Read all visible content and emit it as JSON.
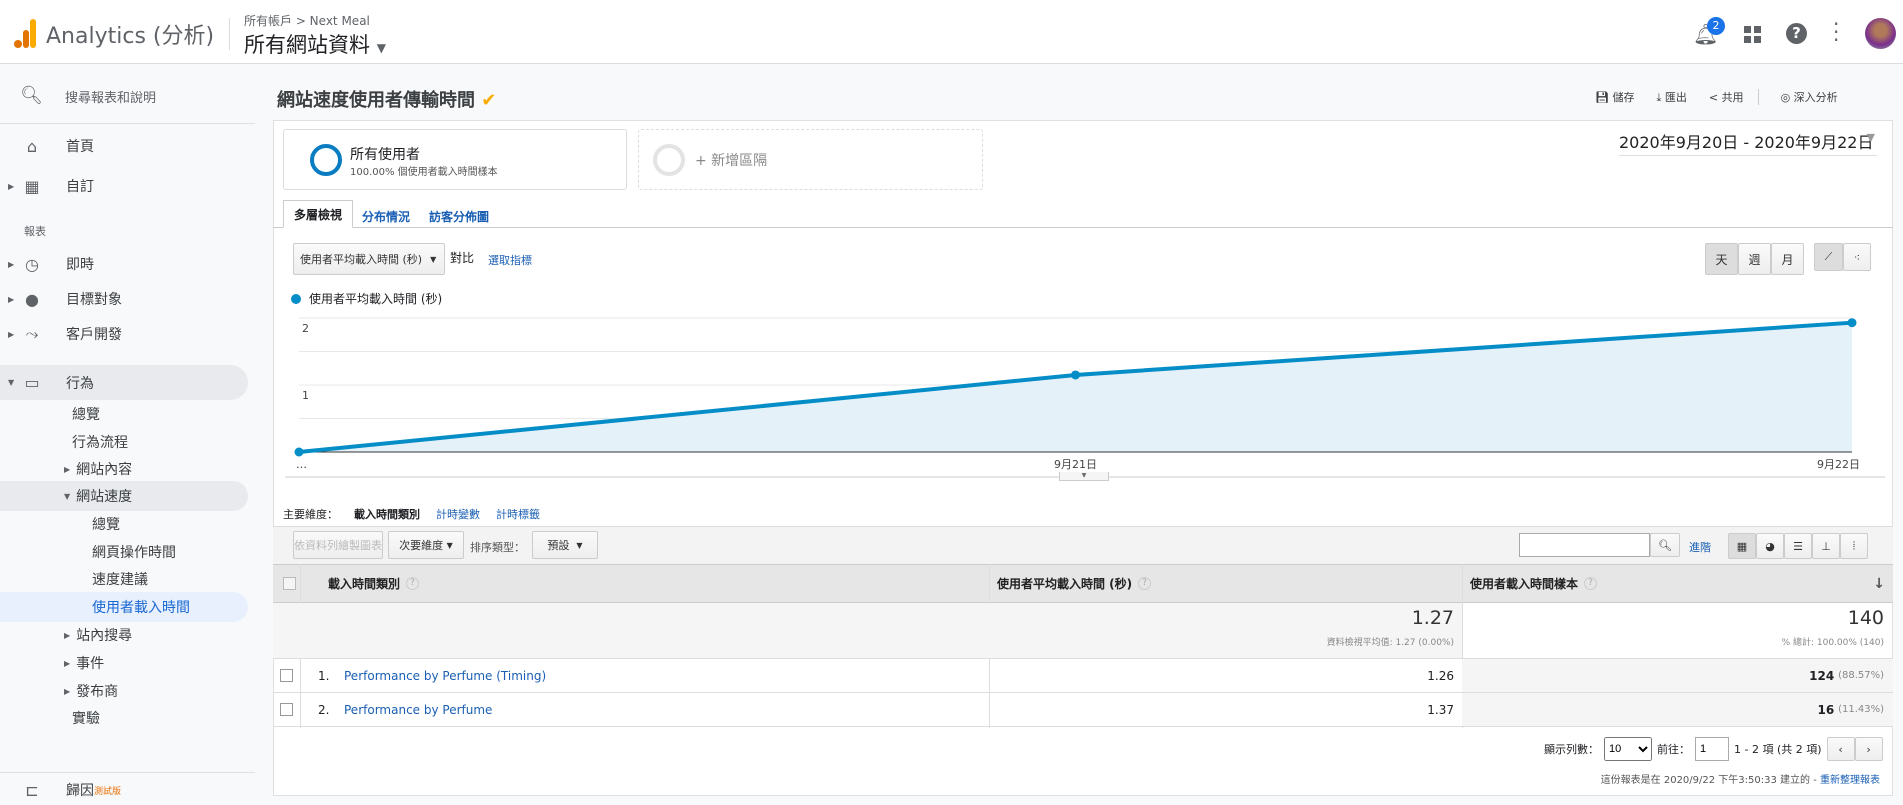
{
  "header": {
    "app_name": "Analytics (分析)",
    "breadcrumb": "所有帳戶 > Next Meal",
    "property": "所有網站資料",
    "notification_count": "2",
    "logo_colors": [
      "#f9ab00",
      "#e37400"
    ]
  },
  "sidebar": {
    "search": "搜尋報表和說明",
    "home": "首頁",
    "custom": "自訂",
    "reports_label": "報表",
    "realtime": "即時",
    "audience": "目標對象",
    "acquisition": "客戶開發",
    "behavior": "行為",
    "behavior_items": [
      "總覽",
      "行為流程",
      "網站內容",
      "網站速度"
    ],
    "speed_items": [
      "總覽",
      "網頁操作時間",
      "速度建議",
      "使用者載入時間"
    ],
    "more_items": [
      "站內搜尋",
      "事件",
      "發布商",
      "實驗"
    ],
    "attribution": "歸因",
    "beta": "測試版"
  },
  "page": {
    "title": "網站速度使用者傳輸時間",
    "actions": {
      "save": "儲存",
      "export": "匯出",
      "share": "共用",
      "insights": "深入分析"
    },
    "date_range": "2020年9月20日 - 2020年9月22日",
    "segment": {
      "name": "所有使用者",
      "desc": "100.00% 個使用者載入時間樣本",
      "add": "+ 新增區隔"
    },
    "tabs": [
      "多層檢視",
      "分布情況",
      "訪客分佈圖"
    ],
    "metric_select": "使用者平均載入時間 (秒)",
    "vs": "對比",
    "select_metric": "選取指標",
    "period": [
      "天",
      "週",
      "月"
    ]
  },
  "chart_data": {
    "type": "area",
    "series": [
      {
        "name": "使用者平均載入時間 (秒)",
        "values": [
          0,
          1.15,
          1.93
        ]
      }
    ],
    "x": [
      "…",
      "9月21日",
      "9月22日"
    ],
    "y_ticks": [
      "1",
      "2"
    ],
    "ylim": [
      0,
      2
    ],
    "grid": true,
    "color": "#058dc7",
    "legend": "top-left"
  },
  "table": {
    "primary_dim_label": "主要維度：",
    "dims": [
      "載入時間類別",
      "計時變數",
      "計時標籤"
    ],
    "plot_rows": "依資料列繪製圖表",
    "secondary_dim": "次要維度",
    "sort_type": "排序類型：",
    "sort_default": "預設",
    "advanced": "進階",
    "columns": [
      "載入時間類別",
      "使用者平均載入時間 (秒)",
      "使用者載入時間樣本"
    ],
    "totals": {
      "avg": "1.27",
      "avg_sub": "資料檢視平均值: 1.27 (0.00%)",
      "samples": "140",
      "samples_sub": "% 總計: 100.00% (140)"
    },
    "rows": [
      {
        "idx": "1.",
        "name": "Performance by Perfume (Timing)",
        "avg": "1.26",
        "samples": "124",
        "pct": "(88.57%)"
      },
      {
        "idx": "2.",
        "name": "Performance by Perfume",
        "avg": "1.37",
        "samples": "16",
        "pct": "(11.43%)"
      }
    ],
    "show_rows": "顯示列數：",
    "rows_value": "10",
    "goto": "前往：",
    "goto_value": "1",
    "range": "1 - 2 項 (共 2 項)",
    "footer": "這份報表是在 2020/9/22 下午3:50:33 建立的 - ",
    "refresh": "重新整理報表"
  }
}
